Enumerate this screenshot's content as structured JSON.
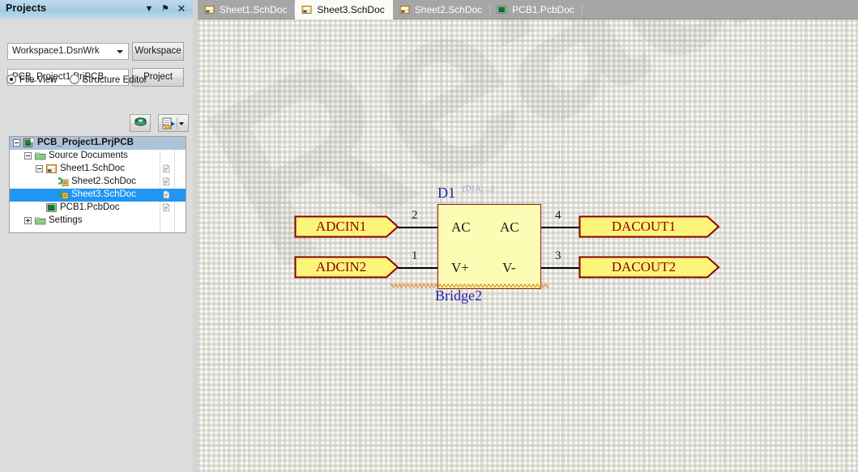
{
  "panel": {
    "title": "Projects",
    "titlebar_buttons": [
      {
        "name": "dropdown-icon",
        "glyph": "▼"
      },
      {
        "name": "pin-icon",
        "glyph": "⚑"
      },
      {
        "name": "close-icon",
        "glyph": "✕"
      }
    ],
    "workspace_combo_value": "Workspace1.DsnWrk",
    "workspace_button_label": "Workspace",
    "project_textbox_value": "PCB_Project1.PrjPCB",
    "project_button_label": "Project",
    "view_modes": [
      {
        "label": "File View",
        "checked": true
      },
      {
        "label": "Structure Editor",
        "checked": false
      }
    ],
    "toolbar_buttons": [
      {
        "name": "compile-icon",
        "label": ""
      },
      {
        "name": "open-document-icon",
        "label": ""
      }
    ]
  },
  "tree": {
    "rows": [
      {
        "label": "PCB_Project1.PrjPCB",
        "depth": 0,
        "expander": "minus",
        "icon": "pcb-project-icon",
        "selected_soft": true,
        "selected": false,
        "has_doc_icon": false
      },
      {
        "label": "Source Documents",
        "depth": 1,
        "expander": "minus",
        "icon": "folder-icon",
        "selected_soft": false,
        "selected": false,
        "has_doc_icon": false
      },
      {
        "label": "Sheet1.SchDoc",
        "depth": 2,
        "expander": "minus",
        "icon": "schematic-icon",
        "selected_soft": false,
        "selected": false,
        "has_doc_icon": true
      },
      {
        "label": "Sheet2.SchDoc",
        "depth": 3,
        "expander": "none",
        "icon": "sheet-link-icon",
        "selected_soft": false,
        "selected": false,
        "has_doc_icon": true
      },
      {
        "label": "Sheet3.SchDoc",
        "depth": 3,
        "expander": "none",
        "icon": "sheet-link-icon",
        "selected_soft": false,
        "selected": true,
        "has_doc_icon": true
      },
      {
        "label": "PCB1.PcbDoc",
        "depth": 2,
        "expander": "none",
        "icon": "pcb-doc-icon",
        "selected_soft": false,
        "selected": false,
        "has_doc_icon": true
      },
      {
        "label": "Settings",
        "depth": 1,
        "expander": "plus",
        "icon": "folder-icon",
        "selected_soft": false,
        "selected": false,
        "has_doc_icon": false
      }
    ]
  },
  "tabs": [
    {
      "label": "Sheet1.SchDoc",
      "icon": "schematic-icon",
      "active": false
    },
    {
      "label": "Sheet3.SchDoc",
      "icon": "schematic-icon",
      "active": true
    },
    {
      "label": "Sheet2.SchDoc",
      "icon": "schematic-icon",
      "active": false
    },
    {
      "label": "PCB1.PcbDoc",
      "icon": "pcb-doc-icon",
      "active": false
    }
  ],
  "canvas": {
    "watermark_text": "Read O",
    "background_color": "#fffdf5"
  },
  "schematic": {
    "component": {
      "designator": "D1",
      "designator_suffix": "(D1A, ...)",
      "comment": "Bridge2",
      "body_color": "#fdfcb5",
      "body_border_color": "#8b2500",
      "pins": [
        {
          "number": "2",
          "name": "AC",
          "side": "left",
          "row": 1
        },
        {
          "number": "1",
          "name": "V+",
          "side": "left",
          "row": 2
        },
        {
          "number": "4",
          "name": "AC",
          "side": "right",
          "row": 1
        },
        {
          "number": "3",
          "name": "V-",
          "side": "right",
          "row": 2
        }
      ]
    },
    "ports": [
      {
        "name": "ADCIN1",
        "side": "left",
        "row": 1,
        "fill": "#fdf47a",
        "border": "#8b0000",
        "text_color": "#8b0000"
      },
      {
        "name": "ADCIN2",
        "side": "left",
        "row": 2,
        "fill": "#fdf47a",
        "border": "#8b0000",
        "text_color": "#8b0000"
      },
      {
        "name": "DACOUT1",
        "side": "right",
        "row": 1,
        "fill": "#fdf47a",
        "border": "#8b0000",
        "text_color": "#8b0000"
      },
      {
        "name": "DACOUT2",
        "side": "right",
        "row": 2,
        "fill": "#fdf47a",
        "border": "#8b0000",
        "text_color": "#8b0000"
      }
    ],
    "error_marker": {
      "name": "compile-error-squiggle",
      "color": "#e8700a"
    }
  }
}
